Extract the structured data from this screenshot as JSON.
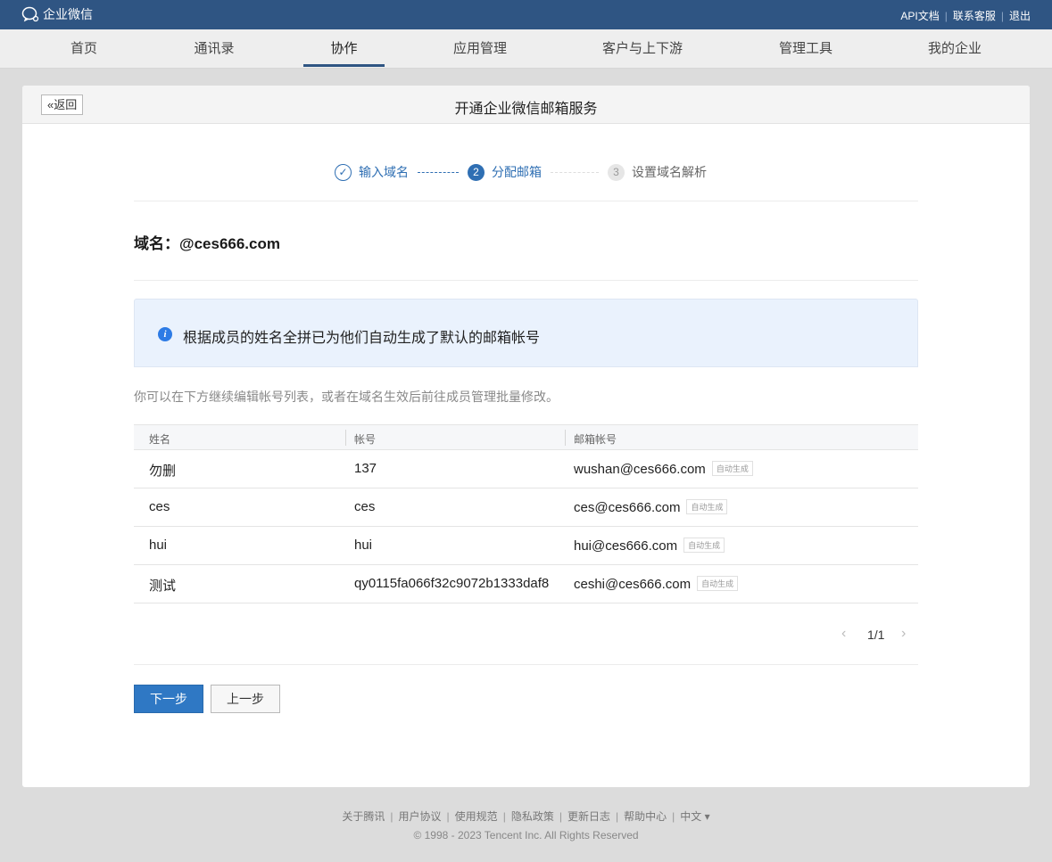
{
  "topbar": {
    "logo_text": "企业微信",
    "links": [
      "API文档",
      "联系客服",
      "退出"
    ]
  },
  "nav": {
    "items": [
      "首页",
      "通讯录",
      "协作",
      "应用管理",
      "客户与上下游",
      "管理工具",
      "我的企业"
    ],
    "active": "协作"
  },
  "card": {
    "back_label": "«返回",
    "title": "开通企业微信邮箱服务"
  },
  "steps": [
    {
      "num": "✓",
      "label": "输入域名",
      "state": "done"
    },
    {
      "num": "2",
      "label": "分配邮箱",
      "state": "active"
    },
    {
      "num": "3",
      "label": "设置域名解析",
      "state": "todo"
    }
  ],
  "domain": {
    "text": "域名：@ces666.com"
  },
  "notice": {
    "text": "根据成员的姓名全拼已为他们自动生成了默认的邮箱帐号"
  },
  "hint": "你可以在下方继续编辑帐号列表，或者在域名生效后前往成员管理批量修改。",
  "table": {
    "headers": [
      "姓名",
      "帐号",
      "邮箱帐号"
    ],
    "auto_tag": "自动生成",
    "rows": [
      {
        "name": "勿删",
        "account": "137",
        "email": "wushan@ces666.com"
      },
      {
        "name": "ces",
        "account": "ces",
        "email": "ces@ces666.com"
      },
      {
        "name": "hui",
        "account": "hui",
        "email": "hui@ces666.com"
      },
      {
        "name": "测试",
        "account": "qy0115fa066f32c9072b1333daf8",
        "email": "ceshi@ces666.com"
      }
    ]
  },
  "pager": {
    "prev": "‹",
    "page": "1/1",
    "next": "›"
  },
  "buttons": {
    "next_label": "下一步",
    "prev_label": "上一步"
  },
  "footer": {
    "links": [
      "关于腾讯",
      "用户协议",
      "使用规范",
      "隐私政策",
      "更新日志",
      "帮助中心",
      "中文 ▾"
    ],
    "copyright": "© 1998 - 2023 Tencent Inc. All Rights Reserved"
  },
  "colors": {
    "topbar": "#2f5583",
    "accent": "#2f78c4",
    "notice_bg": "#eaf2fd"
  }
}
